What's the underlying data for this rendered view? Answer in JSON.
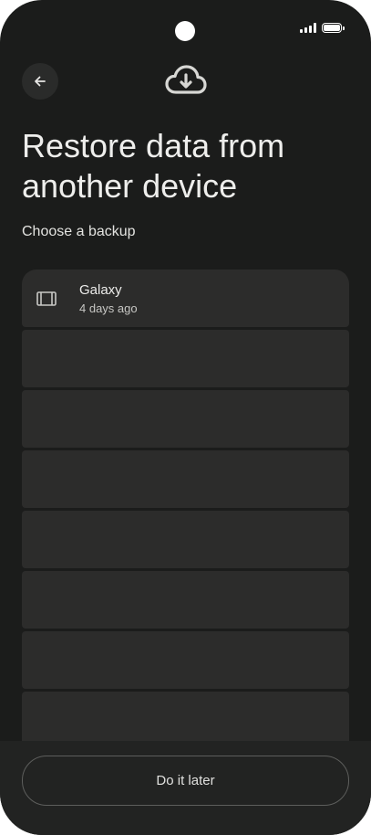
{
  "header": {
    "back_icon": "arrow-left-icon",
    "hero_icon": "cloud-download-icon"
  },
  "page": {
    "title": "Restore data from another device",
    "subtitle": "Choose a backup"
  },
  "backups": [
    {
      "name": "Galaxy",
      "time": "4 days ago",
      "icon": "phone-device-icon"
    },
    {
      "name": "",
      "time": ""
    },
    {
      "name": "",
      "time": ""
    },
    {
      "name": "",
      "time": ""
    },
    {
      "name": "",
      "time": ""
    },
    {
      "name": "",
      "time": ""
    },
    {
      "name": "",
      "time": ""
    },
    {
      "name": "",
      "time": ""
    }
  ],
  "footer": {
    "do_later_label": "Do it later"
  },
  "colors": {
    "background": "#1b1c1b",
    "card": "#2c2c2b",
    "text": "#e8e8e6"
  }
}
